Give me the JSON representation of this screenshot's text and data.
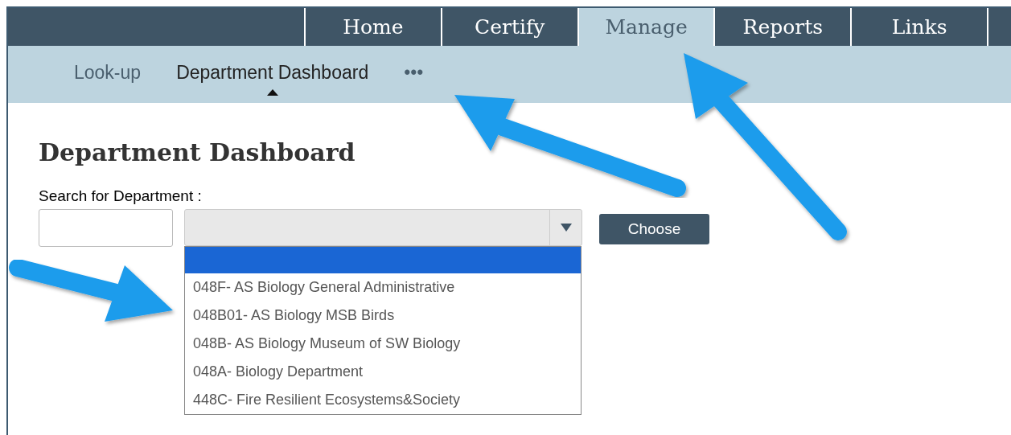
{
  "nav_tabs": [
    {
      "label": "Home",
      "selected": false
    },
    {
      "label": "Certify",
      "selected": false
    },
    {
      "label": "Manage",
      "selected": true
    },
    {
      "label": "Reports",
      "selected": false
    },
    {
      "label": "Links",
      "selected": false
    }
  ],
  "subnav": [
    {
      "label": "Look-up",
      "selected": false
    },
    {
      "label": "Department Dashboard",
      "selected": true
    },
    {
      "label": "•••",
      "selected": false
    }
  ],
  "heading": "Department Dashboard",
  "search": {
    "label": "Search for Department :",
    "button": "Choose"
  },
  "dropdown": {
    "blank_option_highlighted": true,
    "options": [
      {
        "label": "048F- AS Biology General Administrative",
        "selected": false
      },
      {
        "label": "048B01- AS Biology MSB Birds",
        "selected": false
      },
      {
        "label": "048B- AS Biology Museum of SW Biology",
        "selected": false
      },
      {
        "label": "048A- Biology Department",
        "selected": false
      },
      {
        "label": "448C- Fire Resilient Ecosystems&Society",
        "selected": false
      }
    ]
  }
}
